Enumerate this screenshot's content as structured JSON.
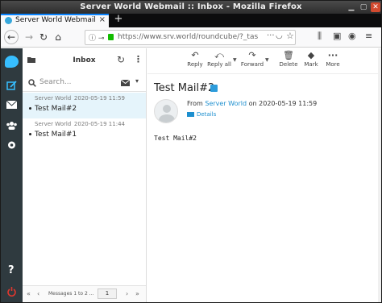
{
  "window": {
    "title": "Server World Webmail :: Inbox - Mozilla Firefox"
  },
  "browser": {
    "tab_title": "Server World Webmail",
    "url": "https://www.srv.world/roundcube/?_tas",
    "new_tab_label": "+"
  },
  "mailbox": {
    "title": "Inbox",
    "search_placeholder": "Search..."
  },
  "messages": [
    {
      "from": "Server World",
      "date": "2020-05-19 11:59",
      "subject": "Test Mail#2",
      "selected": true
    },
    {
      "from": "Server World",
      "date": "2020-05-19 11:44",
      "subject": "Test Mail#1",
      "selected": false
    }
  ],
  "pager": {
    "count_text": "Messages 1 to 2 ...",
    "page": "1"
  },
  "toolbar": {
    "reply": "Reply",
    "reply_all": "Reply all",
    "forward": "Forward",
    "delete": "Delete",
    "mark": "Mark",
    "more": "More"
  },
  "message": {
    "subject": "Test Mail#2",
    "from_prefix": "From",
    "sender": "Server World",
    "on_text": "on 2020-05-19 11:59",
    "details_label": "Details",
    "body": "Test Mail#2"
  },
  "colors": {
    "rail_bg": "#2f3a3f",
    "accent": "#37beff",
    "selected_row": "#e5f4fb",
    "link": "#1d8fcf",
    "logout": "#e0372e"
  }
}
